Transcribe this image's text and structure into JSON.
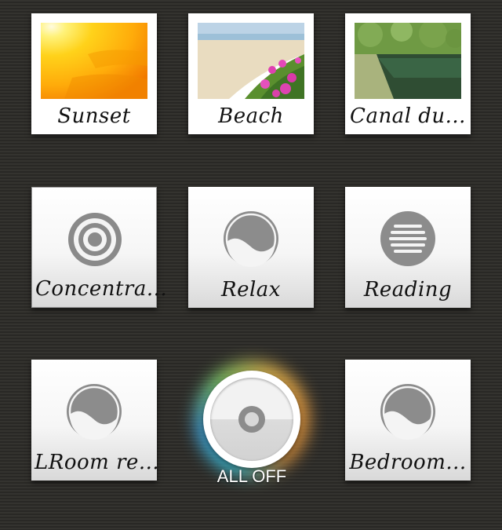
{
  "scenes": [
    {
      "label": "Sunset",
      "icon": "sunset-photo"
    },
    {
      "label": "Beach",
      "icon": "beach-photo"
    },
    {
      "label": "Canal du...",
      "icon": "canal-photo"
    },
    {
      "label": "Concentra...",
      "icon": "concentric-circles-icon"
    },
    {
      "label": "Relax",
      "icon": "yin-wave-icon"
    },
    {
      "label": "Reading",
      "icon": "horizontal-lines-icon"
    },
    {
      "label": "LRoom re...",
      "icon": "yin-wave-icon"
    },
    {
      "label": "Bedroom...",
      "icon": "yin-wave-icon"
    }
  ],
  "all_off": {
    "label": "ALL OFF",
    "icon": "power-dot-icon"
  }
}
